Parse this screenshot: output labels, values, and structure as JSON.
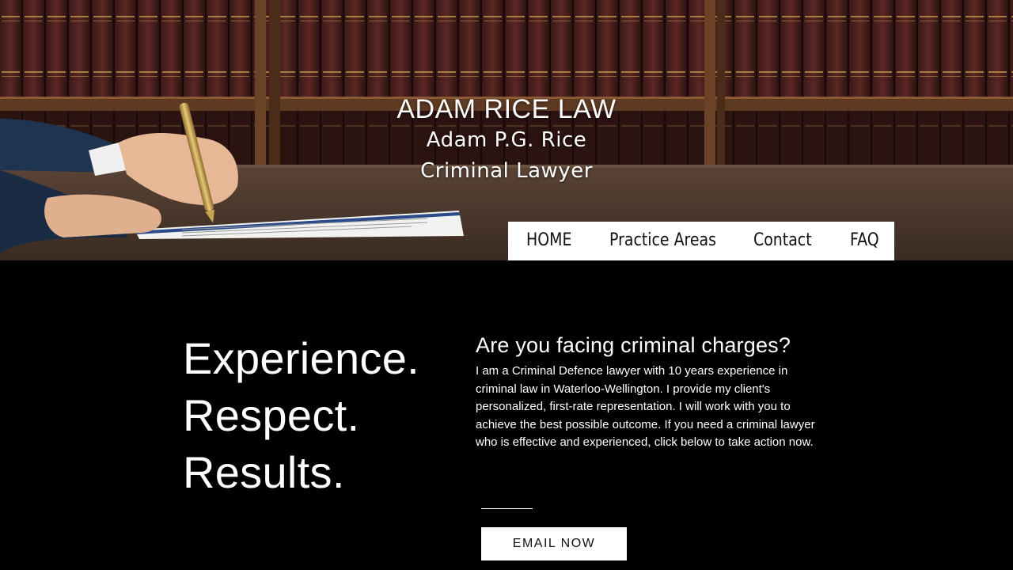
{
  "header": {
    "firm_name": "ADAM RICE LAW",
    "lawyer_name": "Adam P.G. Rice",
    "lawyer_role": "Criminal Lawyer"
  },
  "nav": {
    "items": [
      {
        "label": "HOME"
      },
      {
        "label": "Practice Areas"
      },
      {
        "label": "Contact"
      },
      {
        "label": "FAQ"
      }
    ]
  },
  "main": {
    "tagline": [
      "Experience.",
      "Respect.",
      "Results."
    ],
    "intro_heading": "Are you facing criminal charges?",
    "intro_body": "I am a Criminal Defence lawyer with 10 years experience in criminal law in Waterloo-Wellington. I provide my client's personalized, first-rate representation. I will work with you to achieve the best possible outcome. If you need a criminal lawyer who is effective and experienced, click below to take action now.",
    "cta_label": "EMAIL NOW"
  },
  "colors": {
    "background": "#000000",
    "text": "#ffffff",
    "nav_background": "#ffffff",
    "button_background": "#ffffff"
  }
}
